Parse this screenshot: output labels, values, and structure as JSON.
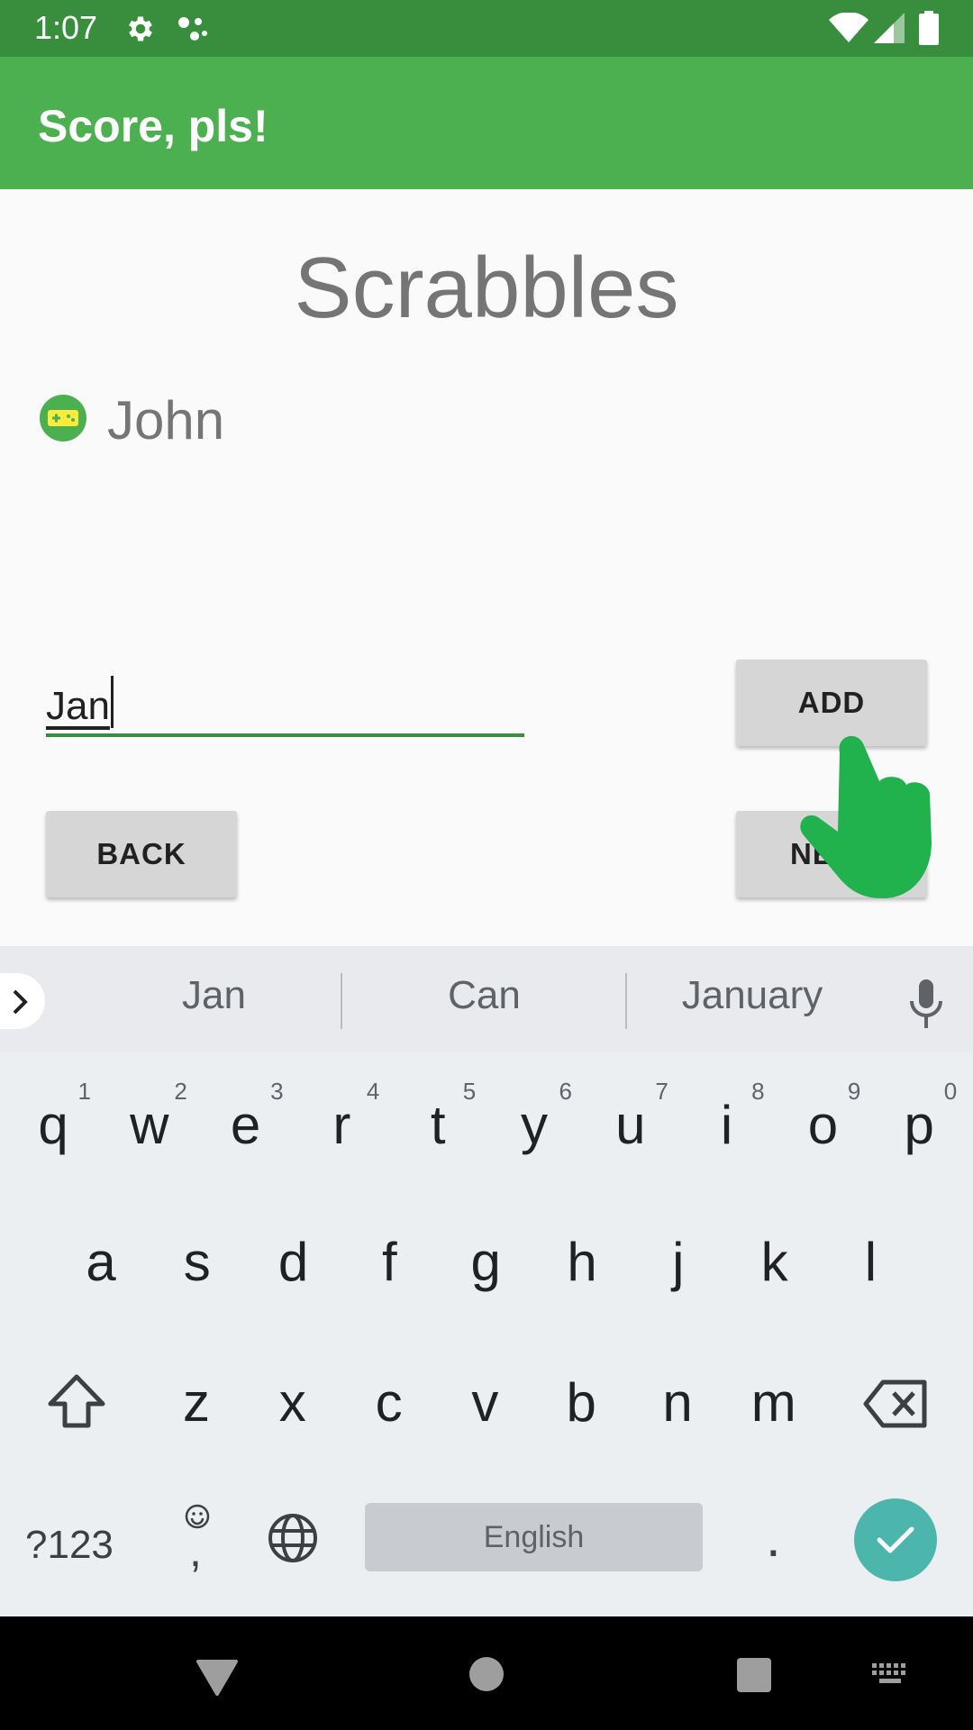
{
  "status_bar": {
    "time": "1:07"
  },
  "app_bar": {
    "title": "Score, pls!"
  },
  "main": {
    "game_title": "Scrabbles",
    "players": [
      {
        "name": "John",
        "icon": "gamepad-icon",
        "icon_bg": "#4caf50",
        "icon_fg": "#ffeb3b"
      }
    ],
    "name_input": {
      "value": "Jan"
    },
    "add_label": "ADD",
    "back_label": "BACK",
    "next_label": "NEXT"
  },
  "keyboard": {
    "suggestions": [
      "Jan",
      "Can",
      "January"
    ],
    "row1": [
      {
        "ch": "q",
        "sup": "1"
      },
      {
        "ch": "w",
        "sup": "2"
      },
      {
        "ch": "e",
        "sup": "3"
      },
      {
        "ch": "r",
        "sup": "4"
      },
      {
        "ch": "t",
        "sup": "5"
      },
      {
        "ch": "y",
        "sup": "6"
      },
      {
        "ch": "u",
        "sup": "7"
      },
      {
        "ch": "i",
        "sup": "8"
      },
      {
        "ch": "o",
        "sup": "9"
      },
      {
        "ch": "p",
        "sup": "0"
      }
    ],
    "row2": [
      "a",
      "s",
      "d",
      "f",
      "g",
      "h",
      "j",
      "k",
      "l"
    ],
    "row3": [
      "z",
      "x",
      "c",
      "v",
      "b",
      "n",
      "m"
    ],
    "symbols_label": "?123",
    "space_label": "English",
    "period_label": ".",
    "comma_label": ","
  },
  "colors": {
    "status_bar": "#388e3c",
    "app_bar": "#4caf50",
    "accent": "#388e3c",
    "enter_key": "#4db6ac"
  }
}
